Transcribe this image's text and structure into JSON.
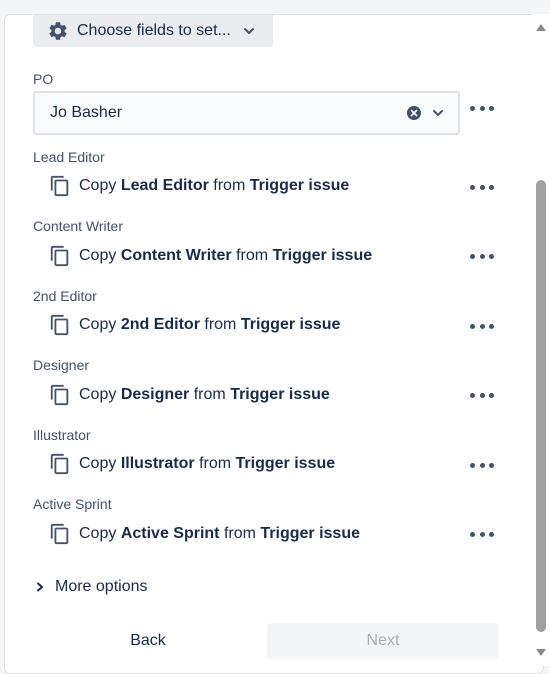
{
  "header": {
    "choose_fields_label": "Choose fields to set..."
  },
  "po": {
    "label": "PO",
    "value": "Jo Basher"
  },
  "fields": [
    {
      "label": "Lead Editor",
      "copy": "Copy",
      "field": "Lead Editor",
      "from": "from",
      "source": "Trigger issue"
    },
    {
      "label": "Content Writer",
      "copy": "Copy",
      "field": "Content Writer",
      "from": "from",
      "source": "Trigger issue"
    },
    {
      "label": "2nd Editor",
      "copy": "Copy",
      "field": "2nd Editor",
      "from": "from",
      "source": "Trigger issue"
    },
    {
      "label": "Designer",
      "copy": "Copy",
      "field": "Designer",
      "from": "from",
      "source": "Trigger issue"
    },
    {
      "label": "Illustrator",
      "copy": "Copy",
      "field": "Illustrator",
      "from": "from",
      "source": "Trigger issue"
    },
    {
      "label": "Active Sprint",
      "copy": "Copy",
      "field": "Active Sprint",
      "from": "from",
      "source": "Trigger issue"
    }
  ],
  "footer": {
    "more_options_label": "More options",
    "back_label": "Back",
    "next_label": "Next"
  },
  "icons": {
    "gear": "gear-icon",
    "chevron": "chevron-down-icon",
    "clear": "clear-icon",
    "copy": "copy-icon",
    "more": "more-icon",
    "chevron_right": "chevron-right-icon"
  },
  "colors": {
    "text": "#172b4d",
    "muted": "#42526e",
    "disabled": "#a5adba",
    "button_bg": "#ebecf0"
  }
}
